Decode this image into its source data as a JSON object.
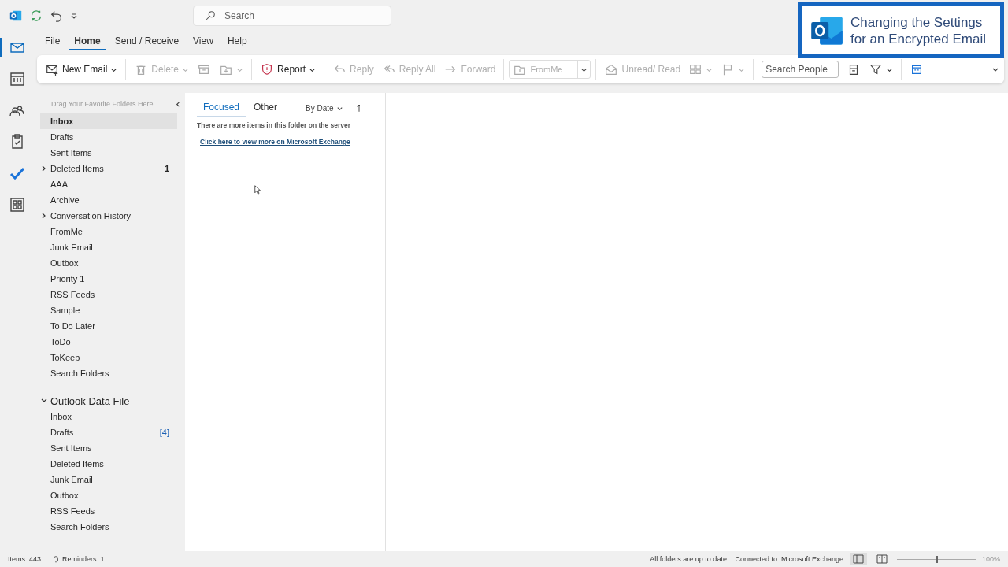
{
  "quick_access": {
    "search": {
      "placeholder": "Search"
    }
  },
  "nav_rail": [
    {
      "selected": true
    },
    {
      "selected": false
    },
    {
      "selected": false
    },
    {
      "selected": false
    },
    {
      "selected": false
    },
    {
      "selected": false
    }
  ],
  "menu_tabs": [
    {
      "label": "File",
      "selected": false
    },
    {
      "label": "Home",
      "selected": true
    },
    {
      "label": "Send / Receive",
      "selected": false
    },
    {
      "label": "View",
      "selected": false
    },
    {
      "label": "Help",
      "selected": false
    }
  ],
  "ribbon": {
    "groups": [
      [
        {
          "kind": "button",
          "label": "New Email",
          "disabled": false,
          "dropdown": true
        }
      ],
      [
        {
          "kind": "button",
          "label": "Delete",
          "disabled": true,
          "dropdown": true
        },
        {
          "kind": "icon",
          "disabled": true,
          "dropdown": false
        },
        {
          "kind": "icon",
          "disabled": true,
          "dropdown": true
        }
      ],
      [
        {
          "kind": "button",
          "label": "Report",
          "disabled": false,
          "dropdown": true
        }
      ],
      [
        {
          "kind": "button",
          "label": "Reply",
          "disabled": true,
          "dropdown": false
        },
        {
          "kind": "button",
          "label": "Reply All",
          "disabled": true,
          "dropdown": false
        },
        {
          "kind": "button",
          "label": "Forward",
          "disabled": true,
          "dropdown": false
        }
      ],
      [
        {
          "kind": "combo",
          "label": "FromMe",
          "disabled": true
        }
      ],
      [
        {
          "kind": "button",
          "label": "Unread/ Read",
          "disabled": true,
          "dropdown": false
        },
        {
          "kind": "icon",
          "disabled": true,
          "dropdown": true
        },
        {
          "kind": "icon",
          "disabled": true,
          "dropdown": true
        }
      ],
      [
        {
          "kind": "field",
          "placeholder": "Search People"
        },
        {
          "kind": "icon",
          "disabled": false,
          "dropdown": false
        },
        {
          "kind": "icon",
          "disabled": false,
          "dropdown": true
        }
      ],
      [
        {
          "kind": "icon",
          "disabled": false,
          "dropdown": false
        }
      ]
    ]
  },
  "folder_pane": {
    "hint": "Drag Your Favorite Folders Here",
    "favorites": [
      {
        "name": "Inbox",
        "selected": true,
        "collapsed": false
      },
      {
        "name": "Drafts",
        "selected": false,
        "collapsed": false
      },
      {
        "name": "Sent Items",
        "selected": false,
        "collapsed": false
      },
      {
        "name": "Deleted Items",
        "count": "1",
        "selected": false,
        "collapsed": true
      },
      {
        "name": "AAA",
        "selected": false,
        "collapsed": false
      },
      {
        "name": "Archive",
        "selected": false,
        "collapsed": false
      },
      {
        "name": "Conversation History",
        "selected": false,
        "collapsed": true
      },
      {
        "name": "FromMe",
        "selected": false,
        "collapsed": false
      },
      {
        "name": "Junk Email",
        "selected": false,
        "collapsed": false
      },
      {
        "name": "Outbox",
        "selected": false,
        "collapsed": false
      },
      {
        "name": "Priority 1",
        "selected": false,
        "collapsed": false
      },
      {
        "name": "RSS Feeds",
        "selected": false,
        "collapsed": false
      },
      {
        "name": "Sample",
        "selected": false,
        "collapsed": false
      },
      {
        "name": "To Do Later",
        "selected": false,
        "collapsed": false
      },
      {
        "name": "ToDo",
        "selected": false,
        "collapsed": false
      },
      {
        "name": "ToKeep",
        "selected": false,
        "collapsed": false
      },
      {
        "name": "Search Folders",
        "selected": false,
        "collapsed": false
      }
    ],
    "account": {
      "name": "Outlook Data File",
      "expanded": true,
      "children": [
        {
          "name": "Inbox",
          "selected": false
        },
        {
          "name": "Drafts",
          "count": "[4]",
          "selected": false
        },
        {
          "name": "Sent Items",
          "selected": false
        },
        {
          "name": "Deleted Items",
          "selected": false
        },
        {
          "name": "Junk Email",
          "selected": false
        },
        {
          "name": "Outbox",
          "selected": false
        },
        {
          "name": "RSS Feeds",
          "selected": false
        },
        {
          "name": "Search Folders",
          "selected": false
        }
      ]
    }
  },
  "message_list": {
    "tabs": [
      {
        "label": "Focused",
        "selected": true
      },
      {
        "label": "Other",
        "selected": false
      }
    ],
    "sort": "By Date",
    "notice": "There are more items in this folder on the server",
    "link": "Click here to view more on Microsoft Exchange"
  },
  "status_bar": {
    "items": "Items: 443",
    "reminders": "Reminders: 1",
    "sync": "All folders are up to date.",
    "connection": "Connected to: Microsoft Exchange",
    "zoom": {
      "level": 0.5,
      "reading": "100%"
    }
  },
  "title_card": {
    "lines": [
      "Changing the Settings",
      "for an Encrypted Email"
    ]
  }
}
